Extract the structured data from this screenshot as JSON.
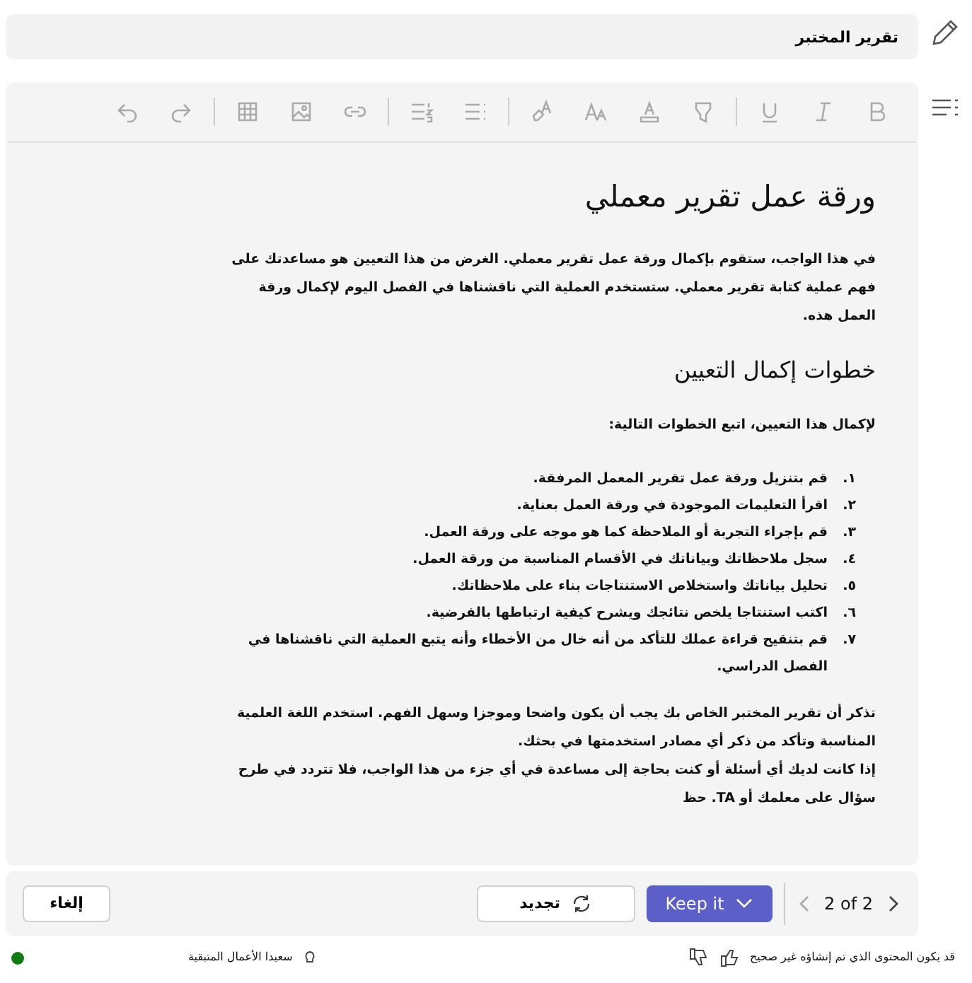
{
  "title_field": {
    "value": "تقرير المختبر"
  },
  "document": {
    "heading": "ورقة عمل تقرير معملي",
    "intro": "في هذا الواجب، ستقوم بإكمال ورقة عمل تقرير معملي. الغرض من هذا التعيين هو مساعدتك على فهم عملية كتابة تقرير معملي. ستستخدم العملية التي ناقشناها في الفصل اليوم لإكمال ورقة العمل هذه.",
    "subheading": "خطوات إكمال التعيين",
    "steps_intro": "لإكمال هذا التعيين، اتبع الخطوات التالية:",
    "steps": [
      {
        "number": "١.",
        "text": "قم بتنزيل ورقة عمل تقرير المعمل المرفقة."
      },
      {
        "number": "٢.",
        "text": "اقرأ التعليمات الموجودة في ورقة العمل بعناية."
      },
      {
        "number": "٣.",
        "text": "قم بإجراء التجربة أو الملاحظة كما هو موجه على ورقة العمل."
      },
      {
        "number": "٤.",
        "text": "سجل ملاحظاتك وبياناتك في الأقسام المناسبة من ورقة العمل."
      },
      {
        "number": "٥.",
        "text": "تحليل بياناتك واستخلاص الاستنتاجات بناء على ملاحظاتك."
      },
      {
        "number": "٦.",
        "text": "اكتب استنتاجا يلخص نتائجك ويشرح كيفية ارتباطها بالفرضية."
      },
      {
        "number": "٧.",
        "text": "قم بتنقيح قراءة عملك للتأكد من أنه خال من الأخطاء وأنه يتبع العملية التي ناقشناها في الفصل الدراسي."
      }
    ],
    "closing": [
      "تذكر أن تقرير المختبر الخاص بك يجب أن يكون واضحا وموجزا وسهل الفهم. استخدم اللغة العلمية المناسبة وتأكد من ذكر أي مصادر استخدمتها في بحثك.",
      "إذا كانت لديك أي أسئلة أو كنت بحاجة إلى مساعدة في أي جزء من هذا الواجب، فلا تتردد في طرح سؤال على معلمك أو TA. حظ"
    ]
  },
  "action_bar": {
    "pager": "2 of 2",
    "keep_button": "Keep it",
    "regenerate_button": "تجديد",
    "cancel_button": "إلغاء"
  },
  "footer": {
    "disclaimer": "قد يكون المحتوى الذي تم إنشاؤه غير صحيح",
    "tip": "سعيدا الأعمال المتبقية"
  }
}
